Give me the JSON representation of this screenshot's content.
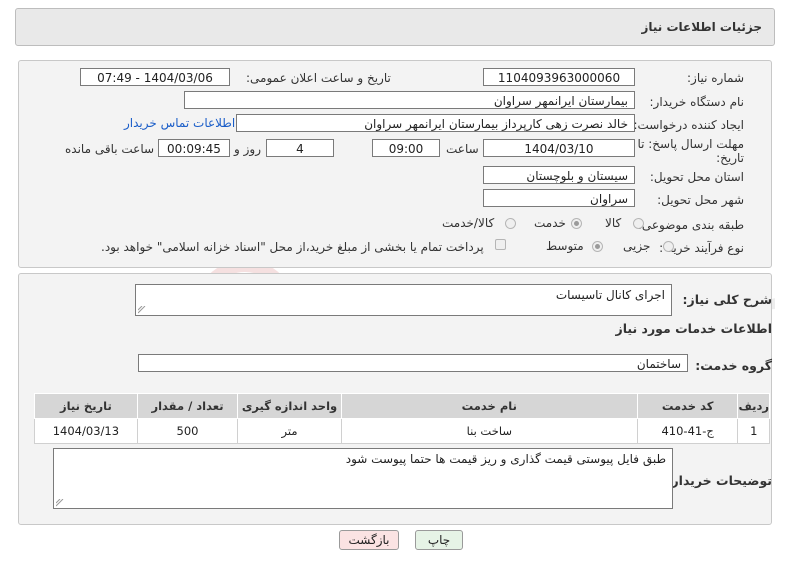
{
  "header": {
    "title": "جزئیات اطلاعات نیاز"
  },
  "form": {
    "need_number": {
      "label": "شماره نیاز:",
      "value": "1104093963000060"
    },
    "announce_datetime": {
      "label": "تاریخ و ساعت اعلان عمومی:",
      "value": "1404/03/06 - 07:49"
    },
    "buyer_org": {
      "label": "نام دستگاه خریدار:",
      "value": "بیمارستان ایرانمهر سراوان"
    },
    "requester": {
      "label": "ایجاد کننده درخواست:",
      "value": "خالد نصرت زهی کارپرداز بیمارستان ایرانمهر سراوان"
    },
    "buyer_contact_link": "اطلاعات تماس خریدار",
    "deadline": {
      "label_line1": "مهلت ارسال پاسخ: تا",
      "label_line2": "تاریخ:",
      "date": "1404/03/10",
      "time_label": "ساعت",
      "time": "09:00",
      "days": "4",
      "days_label": "روز و",
      "remaining": "00:09:45",
      "remaining_label": "ساعت باقی مانده"
    },
    "province": {
      "label": "استان محل تحویل:",
      "value": "سیستان و بلوچستان"
    },
    "city": {
      "label": "شهر محل تحویل:",
      "value": "سراوان"
    },
    "category": {
      "label": "طبقه بندی موضوعی:",
      "options": [
        "کالا",
        "خدمت",
        "کالا/خدمت"
      ],
      "selected": "خدمت"
    },
    "purchase_type": {
      "label": "نوع فرآیند خرید :",
      "options": [
        "جزیی",
        "متوسط"
      ],
      "selected": "متوسط",
      "payment_note": "پرداخت تمام یا بخشی از مبلغ خرید،از محل \"اسناد خزانه اسلامی\" خواهد بود."
    }
  },
  "summary": {
    "label": "شرح کلی نیاز:",
    "value": "اجرای کانال تاسیسات"
  },
  "services": {
    "section_title": "اطلاعات خدمات مورد نیاز",
    "group_label": "گروه خدمت:",
    "group_value": "ساختمان",
    "columns": [
      "ردیف",
      "کد خدمت",
      "نام خدمت",
      "واحد اندازه گیری",
      "تعداد / مقدار",
      "تاریخ نیاز"
    ],
    "rows": [
      {
        "row": "1",
        "code": "ج-41-410",
        "name": "ساخت بنا",
        "unit": "متر",
        "qty": "500",
        "date": "1404/03/13"
      }
    ]
  },
  "buyer_notes": {
    "label": "توضیحات خریدار:",
    "value": "طبق فایل پیوستی قیمت گذاری و ریز قیمت ها حتما پیوست شود"
  },
  "buttons": {
    "print": "چاپ",
    "back": "بازگشت"
  },
  "watermark": "AriaTender.net"
}
